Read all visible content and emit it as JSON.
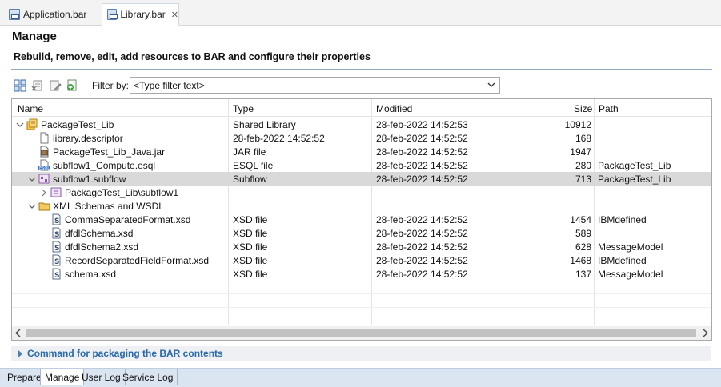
{
  "editor_tabs": [
    {
      "label": "Application.bar",
      "active": false
    },
    {
      "label": "Library.bar",
      "active": true,
      "close": "✕"
    }
  ],
  "page": {
    "title": "Manage",
    "subtitle": "Rebuild, remove, edit, add resources to BAR and configure their properties"
  },
  "toolbar": {
    "icons": [
      "build-bar-icon",
      "remove-icon",
      "edit-icon",
      "add-icon"
    ],
    "filter_label": "Filter by:",
    "filter_value": "<Type filter text>"
  },
  "table": {
    "columns": [
      "Name",
      "Type",
      "Modified",
      "Size",
      "Path"
    ],
    "rows": [
      {
        "name": "PackageTest_Lib",
        "type": "Shared Library",
        "modified": "28-feb-2022  14:52:53",
        "size": "10912",
        "path": "",
        "level": 0,
        "twisty": "open",
        "icon": "library-icon"
      },
      {
        "name": "library.descriptor",
        "type": "28-feb-2022  14:52:52",
        "modified": "28-feb-2022  14:52:52",
        "size": "168",
        "path": "",
        "level": 1,
        "twisty": "none",
        "icon": "file-icon"
      },
      {
        "name": "PackageTest_Lib_Java.jar",
        "type": "JAR file",
        "modified": "28-feb-2022  14:52:52",
        "size": "1947",
        "path": "",
        "level": 1,
        "twisty": "none",
        "icon": "jar-icon"
      },
      {
        "name": "subflow1_Compute.esql",
        "type": "ESQL file",
        "modified": "28-feb-2022  14:52:52",
        "size": "280",
        "path": "PackageTest_Lib",
        "level": 1,
        "twisty": "none",
        "icon": "esql-icon"
      },
      {
        "name": "subflow1.subflow",
        "type": "Subflow",
        "modified": "28-feb-2022  14:52:52",
        "size": "713",
        "path": "PackageTest_Lib",
        "level": 1,
        "twisty": "open",
        "icon": "subflow-icon",
        "selected": true
      },
      {
        "name": "PackageTest_Lib\\subflow1",
        "type": "",
        "modified": "",
        "size": "",
        "path": "",
        "level": 2,
        "twisty": "closed",
        "icon": "subflow-node-icon"
      },
      {
        "name": "XML Schemas and WSDL",
        "type": "",
        "modified": "",
        "size": "",
        "path": "",
        "level": 1,
        "twisty": "open",
        "icon": "folder-icon"
      },
      {
        "name": "CommaSeparatedFormat.xsd",
        "type": "XSD file",
        "modified": "28-feb-2022  14:52:52",
        "size": "1454",
        "path": "IBMdefined",
        "level": 2,
        "twisty": "none",
        "icon": "xsd-icon"
      },
      {
        "name": "dfdlSchema.xsd",
        "type": "XSD file",
        "modified": "28-feb-2022  14:52:52",
        "size": "589",
        "path": "",
        "level": 2,
        "twisty": "none",
        "icon": "xsd-icon"
      },
      {
        "name": "dfdlSchema2.xsd",
        "type": "XSD file",
        "modified": "28-feb-2022  14:52:52",
        "size": "628",
        "path": "MessageModel",
        "level": 2,
        "twisty": "none",
        "icon": "xsd-icon"
      },
      {
        "name": "RecordSeparatedFieldFormat.xsd",
        "type": "XSD file",
        "modified": "28-feb-2022  14:52:52",
        "size": "1468",
        "path": "IBMdefined",
        "level": 2,
        "twisty": "none",
        "icon": "xsd-icon"
      },
      {
        "name": "schema.xsd",
        "type": "XSD file",
        "modified": "28-feb-2022  14:52:52",
        "size": "137",
        "path": "MessageModel",
        "level": 2,
        "twisty": "none",
        "icon": "xsd-icon"
      }
    ]
  },
  "command_section": {
    "label": "Command for packaging the BAR contents"
  },
  "bottom_tabs": [
    {
      "label": "Prepare",
      "active": false
    },
    {
      "label": "Manage",
      "active": true
    },
    {
      "label": "User Log",
      "active": false
    },
    {
      "label": "Service Log",
      "active": false
    }
  ]
}
